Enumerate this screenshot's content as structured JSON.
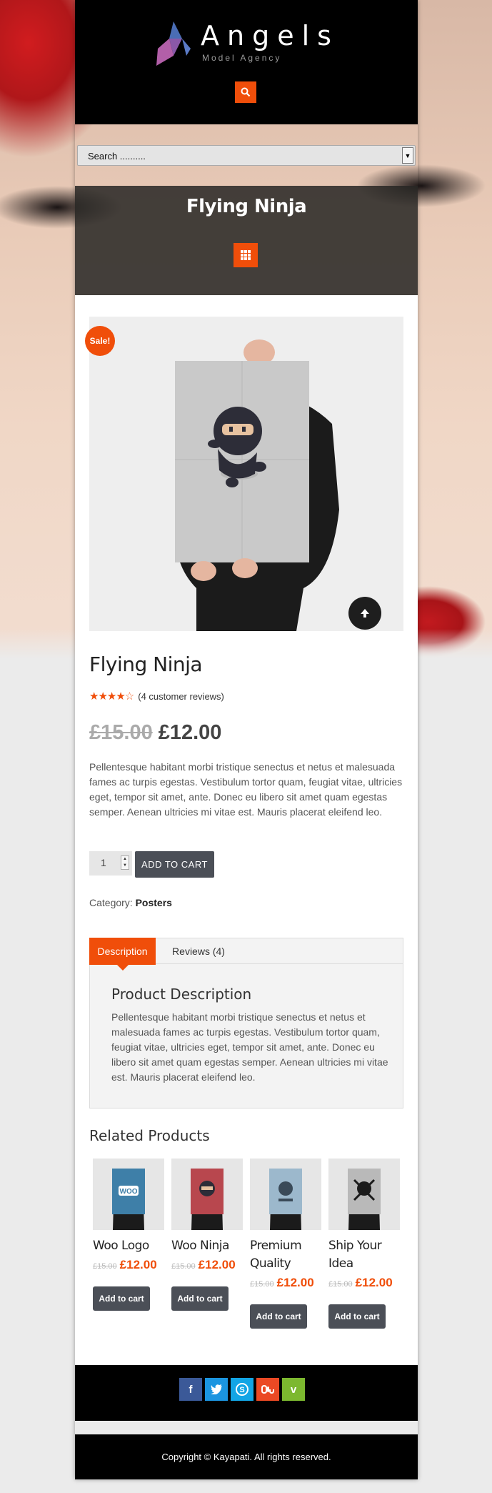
{
  "brand": {
    "name": "Angels",
    "tagline": "Model Agency"
  },
  "search": {
    "placeholder": "Search ..........",
    "toggle_icon": "search-icon"
  },
  "banner": {
    "title": "Flying Ninja",
    "menu_icon": "grid-icon"
  },
  "product": {
    "sale_badge": "Sale!",
    "title": "Flying Ninja",
    "rating": 4,
    "rating_max": 5,
    "reviews_text": "(4 customer reviews)",
    "old_price": "£15.00",
    "price": "£12.00",
    "description": "Pellentesque habitant morbi tristique senectus et netus et malesuada fames ac turpis egestas. Vestibulum tortor quam, feugiat vitae, ultricies eget, tempor sit amet, ante. Donec eu libero sit amet quam egestas semper. Aenean ultricies mi vitae est. Mauris placerat eleifend leo.",
    "quantity": "1",
    "add_to_cart": "ADD TO CART",
    "category_label": "Category:",
    "category_value": "Posters"
  },
  "tabs": {
    "items": [
      "Description",
      "Reviews (4)"
    ],
    "active": "Description",
    "heading": "Product Description",
    "text": "Pellentesque habitant morbi tristique senectus et netus et malesuada fames ac turpis egestas. Vestibulum tortor quam, feugiat vitae, ultricies eget, tempor sit amet, ante. Donec eu libero sit amet quam egestas semper. Aenean ultricies mi vitae est. Mauris placerat eleifend leo."
  },
  "related": {
    "title": "Related Products",
    "items": [
      {
        "name": "Woo Logo",
        "old_price": "£15.00",
        "price": "£12.00",
        "button": "Add to cart",
        "poster_color": "#3e7fa8",
        "poster_label": "WOO"
      },
      {
        "name": "Woo Ninja",
        "old_price": "£15.00",
        "price": "£12.00",
        "button": "Add to cart",
        "poster_color": "#b8474e"
      },
      {
        "name": "Premium Quality",
        "old_price": "£15.00",
        "price": "£12.00",
        "button": "Add to cart",
        "poster_color": "#9cb8cc"
      },
      {
        "name": "Ship Your Idea",
        "old_price": "£15.00",
        "price": "£12.00",
        "button": "Add to cart",
        "poster_color": "#b9b9b9"
      }
    ]
  },
  "footer": {
    "social": [
      {
        "icon": "facebook-icon",
        "glyph": "f",
        "color": "#3b5998"
      },
      {
        "icon": "twitter-icon",
        "glyph": "t",
        "color": "#1b95e0"
      },
      {
        "icon": "skype-icon",
        "glyph": "S",
        "color": "#12a5e5"
      },
      {
        "icon": "stumbleupon-icon",
        "glyph": "su",
        "color": "#eb4924"
      },
      {
        "icon": "vimeo-icon",
        "glyph": "v",
        "color": "#7cb82f"
      }
    ],
    "copyright": "Copyright © Kayapati. All rights reserved."
  },
  "colors": {
    "accent": "#f04e0a",
    "button_dark": "#4b4f57"
  }
}
